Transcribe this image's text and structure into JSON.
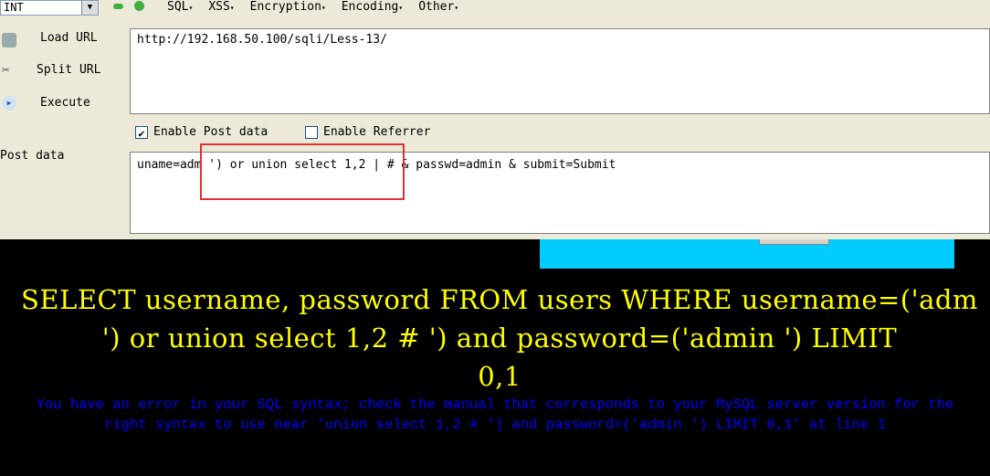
{
  "toolbar": {
    "select_value": "INT",
    "menus": [
      "SQL",
      "XSS",
      "Encryption",
      "Encoding",
      "Other"
    ]
  },
  "side": {
    "load_url": "Load URL",
    "split_url": "Split URL",
    "execute": "Execute",
    "post_data": "Post data"
  },
  "url": {
    "value": "http://192.168.50.100/sqli/Less-13/"
  },
  "options": {
    "enable_post": "Enable Post data",
    "enable_post_checked": true,
    "enable_referrer": "Enable Referrer",
    "enable_referrer_checked": false
  },
  "post": {
    "value": "uname=adm ') or union select 1,2 | # & passwd=admin & submit=Submit"
  },
  "colors": {
    "highlight": "#e03030",
    "query": "#ffff00",
    "error": "#0000ff",
    "banner": "#00ccff"
  },
  "page": {
    "query_lines": [
      "SELECT username, password FROM users WHERE username=('adm",
      "') or union select 1,2 # ') and password=('admin ') LIMIT",
      "0,1"
    ],
    "error_lines": [
      "You have an error in your SQL syntax; check the manual that corresponds to your MySQL server version for the",
      "right syntax to use near 'union select 1,2 # ') and password=('admin ') LIMIT 0,1' at line 1"
    ]
  }
}
